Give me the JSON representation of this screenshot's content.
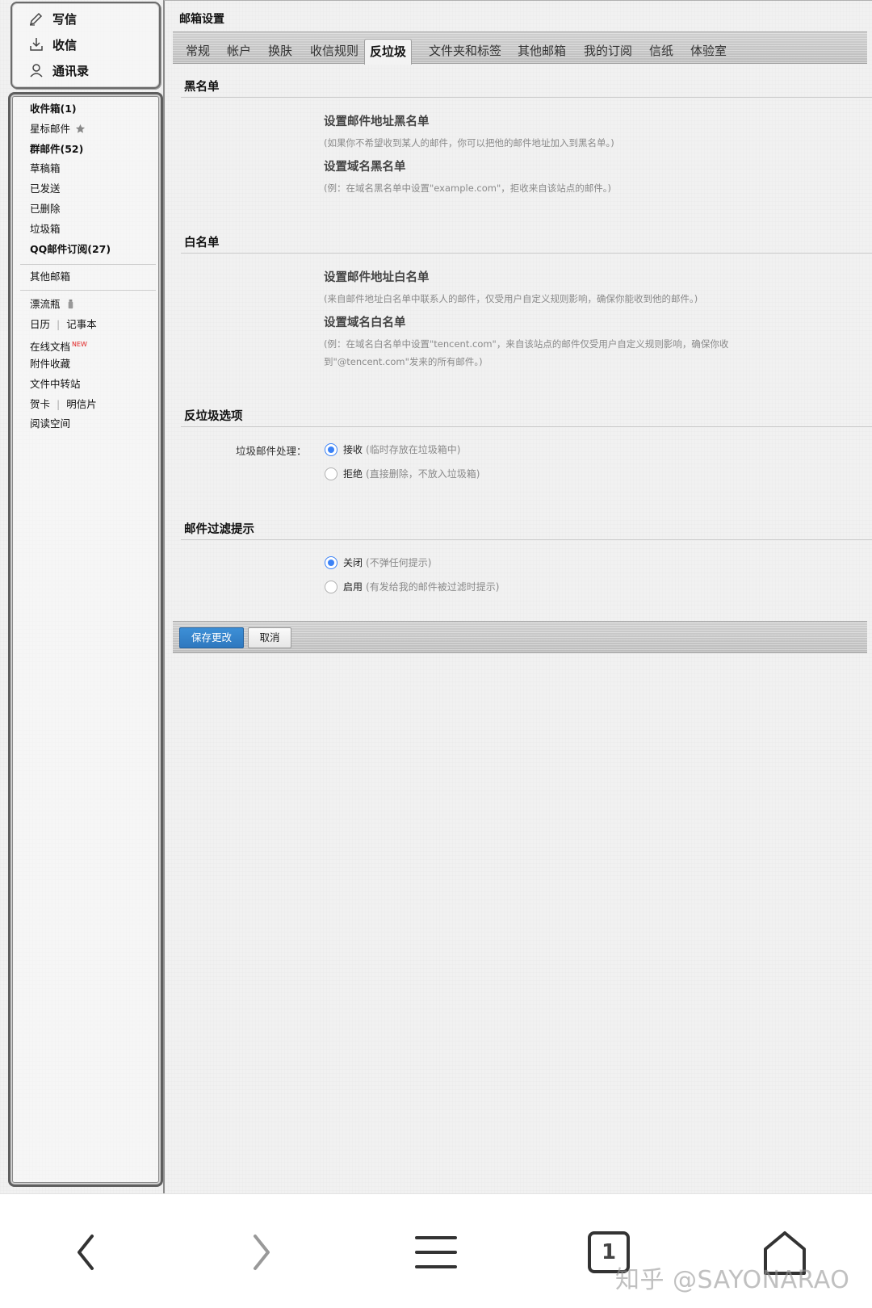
{
  "sidebar": {
    "quick": {
      "compose": "写信",
      "receive": "收信",
      "contacts": "通讯录"
    },
    "folders": [
      {
        "label": "收件箱(1)"
      },
      {
        "label": "星标邮件"
      },
      {
        "label": "群邮件(52)"
      },
      {
        "label": "草稿箱"
      },
      {
        "label": "已发送"
      },
      {
        "label": "已删除"
      },
      {
        "label": "垃圾箱"
      },
      {
        "label": "QQ邮件订阅(27)"
      }
    ],
    "other_mailbox": "其他邮箱",
    "apps": {
      "drift_bottle": "漂流瓶",
      "calendar": "日历",
      "notebook": "记事本",
      "online_docs": "在线文档",
      "new_badge": "NEW",
      "attachments": "附件收藏",
      "file_transfer": "文件中转站",
      "greeting_card": "贺卡",
      "postcard": "明信片",
      "reading_space": "阅读空间"
    }
  },
  "main": {
    "title": "邮箱设置",
    "tabs": [
      {
        "label": "常规"
      },
      {
        "label": "帐户"
      },
      {
        "label": "换肤"
      },
      {
        "label": "收信规则"
      },
      {
        "label": "反垃圾"
      },
      {
        "label": "文件夹和标签"
      },
      {
        "label": "其他邮箱"
      },
      {
        "label": "我的订阅"
      },
      {
        "label": "信纸"
      },
      {
        "label": "体验室"
      }
    ],
    "active_tab": "反垃圾",
    "blacklist": {
      "title": "黑名单",
      "address_link": "设置邮件地址黑名单",
      "address_hint": "(如果你不希望收到某人的邮件，你可以把他的邮件地址加入到黑名单。)",
      "domain_link": "设置域名黑名单",
      "domain_hint": "(例：在域名黑名单中设置\"example.com\"，拒收来自该站点的邮件。)"
    },
    "whitelist": {
      "title": "白名单",
      "address_link": "设置邮件地址白名单",
      "address_hint": "(来自邮件地址白名单中联系人的邮件，仅受用户自定义规则影响，确保你能收到他的邮件。)",
      "domain_link": "设置域名白名单",
      "domain_hint": "(例：在域名白名单中设置\"tencent.com\"，来自该站点的邮件仅受用户自定义规则影响，确保你收到\"@tencent.com\"发来的所有邮件。)"
    },
    "antispam": {
      "title": "反垃圾选项",
      "field_label": "垃圾邮件处理：",
      "options": [
        {
          "label": "接收",
          "note": "(临时存放在垃圾箱中)",
          "checked": true
        },
        {
          "label": "拒绝",
          "note": "(直接删除，不放入垃圾箱)",
          "checked": false
        }
      ]
    },
    "filter_tip": {
      "title": "邮件过滤提示",
      "options": [
        {
          "label": "关闭",
          "note": "(不弹任何提示)",
          "checked": true
        },
        {
          "label": "启用",
          "note": "(有发给我的邮件被过滤时提示)",
          "checked": false
        }
      ]
    },
    "actions": {
      "save": "保存更改",
      "cancel": "取消"
    }
  },
  "browser_nav": {
    "tab_count": "1",
    "icons": [
      "back-icon",
      "forward-icon",
      "menu-icon",
      "tabs-icon",
      "home-icon"
    ]
  },
  "watermark": "知乎 @SAYONARAO",
  "colors": {
    "primary_button": "#2e78bf",
    "radio_checked": "#3b82f6",
    "new_badge": "#e02020"
  }
}
